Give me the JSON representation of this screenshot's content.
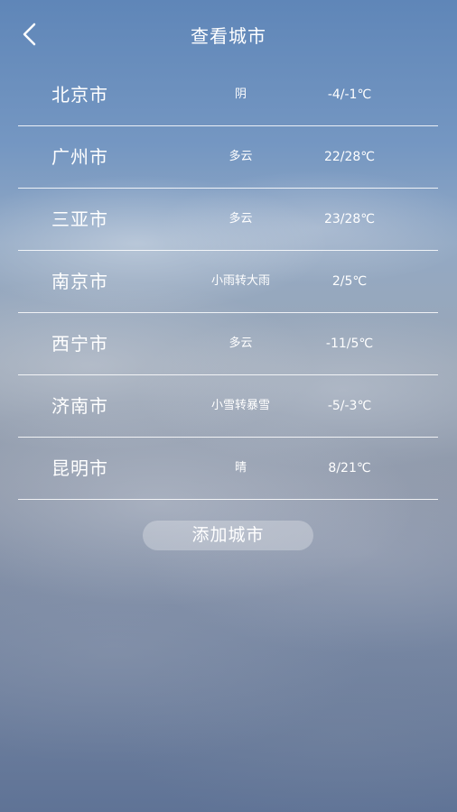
{
  "header": {
    "title": "查看城市",
    "back_icon": "chevron-left-icon"
  },
  "cities": [
    {
      "name": "北京市",
      "weather": "阴",
      "temp": "-4/-1℃"
    },
    {
      "name": "广州市",
      "weather": "多云",
      "temp": "22/28℃"
    },
    {
      "name": "三亚市",
      "weather": "多云",
      "temp": "23/28℃"
    },
    {
      "name": "南京市",
      "weather": "小雨转大雨",
      "temp": "2/5℃"
    },
    {
      "name": "西宁市",
      "weather": "多云",
      "temp": "-11/5℃"
    },
    {
      "name": "济南市",
      "weather": "小雪转暴雪",
      "temp": "-5/-3℃"
    },
    {
      "name": "昆明市",
      "weather": "晴",
      "temp": "8/21℃"
    }
  ],
  "actions": {
    "add_city_label": "添加城市"
  },
  "colors": {
    "text": "#ffffff",
    "divider": "#ffffff"
  }
}
